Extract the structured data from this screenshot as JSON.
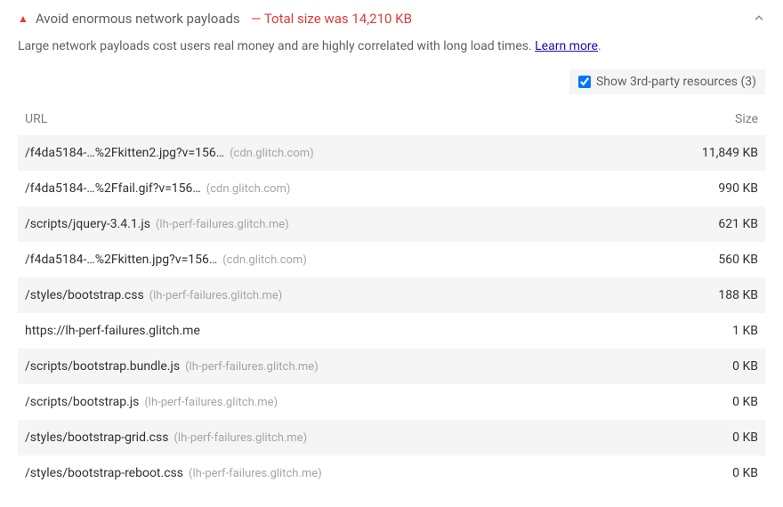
{
  "audit": {
    "title": "Avoid enormous network payloads",
    "totalSizePrefix": "— Total size was ",
    "totalSizeValue": "14,210 KB",
    "description": "Large network payloads cost users real money and are highly correlated with long load times. ",
    "learnMoreLabel": "Learn more",
    "learnMoreSuffix": "."
  },
  "filter": {
    "label": "Show 3rd-party resources (3)",
    "checked": true
  },
  "table": {
    "headers": {
      "url": "URL",
      "size": "Size"
    },
    "rows": [
      {
        "path": "/f4da5184-…%2Fkitten2.jpg?v=156…",
        "origin": "(cdn.glitch.com)",
        "sizeValue": "11,849",
        "sizeUnit": "KB"
      },
      {
        "path": "/f4da5184-…%2Ffail.gif?v=156…",
        "origin": "(cdn.glitch.com)",
        "sizeValue": "990",
        "sizeUnit": "KB"
      },
      {
        "path": "/scripts/jquery-3.4.1.js",
        "origin": "(lh-perf-failures.glitch.me)",
        "sizeValue": "621",
        "sizeUnit": "KB"
      },
      {
        "path": "/f4da5184-…%2Fkitten.jpg?v=156…",
        "origin": "(cdn.glitch.com)",
        "sizeValue": "560",
        "sizeUnit": "KB"
      },
      {
        "path": "/styles/bootstrap.css",
        "origin": "(lh-perf-failures.glitch.me)",
        "sizeValue": "188",
        "sizeUnit": "KB"
      },
      {
        "path": "https://lh-perf-failures.glitch.me",
        "origin": "",
        "sizeValue": "1",
        "sizeUnit": "KB"
      },
      {
        "path": "/scripts/bootstrap.bundle.js",
        "origin": "(lh-perf-failures.glitch.me)",
        "sizeValue": "0",
        "sizeUnit": "KB"
      },
      {
        "path": "/scripts/bootstrap.js",
        "origin": "(lh-perf-failures.glitch.me)",
        "sizeValue": "0",
        "sizeUnit": "KB"
      },
      {
        "path": "/styles/bootstrap-grid.css",
        "origin": "(lh-perf-failures.glitch.me)",
        "sizeValue": "0",
        "sizeUnit": "KB"
      },
      {
        "path": "/styles/bootstrap-reboot.css",
        "origin": "(lh-perf-failures.glitch.me)",
        "sizeValue": "0",
        "sizeUnit": "KB"
      }
    ]
  }
}
